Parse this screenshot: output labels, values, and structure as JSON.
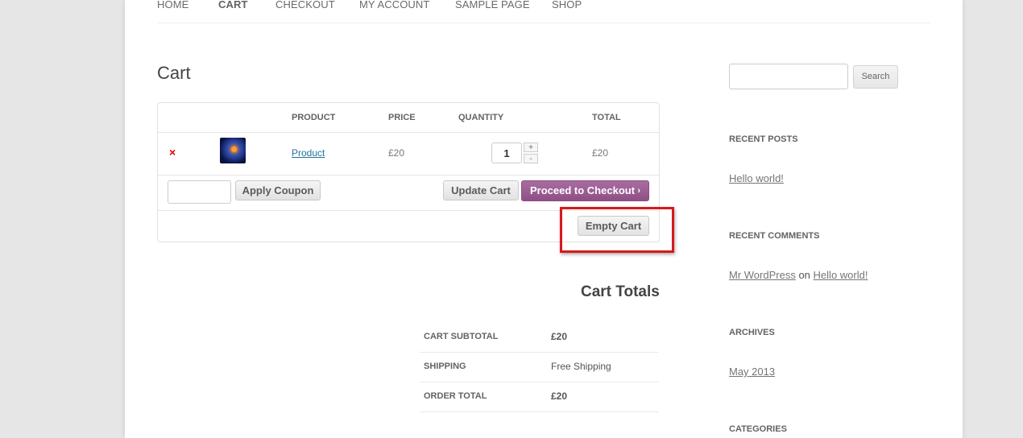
{
  "nav": {
    "items": [
      {
        "label": "HOME"
      },
      {
        "label": "CART",
        "active": true
      },
      {
        "label": "CHECKOUT"
      },
      {
        "label": "MY ACCOUNT"
      },
      {
        "label": "SAMPLE PAGE"
      },
      {
        "label": "SHOP"
      }
    ]
  },
  "page_title": "Cart",
  "cart": {
    "headers": {
      "product": "PRODUCT",
      "price": "PRICE",
      "quantity": "QUANTITY",
      "total": "TOTAL"
    },
    "row": {
      "remove_icon": "×",
      "product_link": "Product",
      "price": "£20",
      "quantity": "1",
      "qty_plus": "+",
      "qty_minus": "-",
      "total": "£20"
    },
    "coupon": {
      "placeholder": "",
      "button": "Apply Coupon"
    },
    "update_button": "Update Cart",
    "checkout_button": "Proceed to Checkout",
    "checkout_chevron": "›",
    "empty_button": "Empty Cart",
    "highlight_color": "#d7191c"
  },
  "totals": {
    "title": "Cart Totals",
    "rows": [
      {
        "label": "CART SUBTOTAL",
        "value": "£20"
      },
      {
        "label": "SHIPPING",
        "value": "Free Shipping"
      },
      {
        "label": "ORDER TOTAL",
        "value": "£20"
      }
    ]
  },
  "sidebar": {
    "search": {
      "placeholder": "",
      "button": "Search"
    },
    "recent_posts": {
      "title": "RECENT POSTS",
      "items": [
        "Hello world!"
      ]
    },
    "recent_comments": {
      "title": "RECENT COMMENTS",
      "author": "Mr WordPress",
      "on": "on",
      "post": "Hello world!"
    },
    "archives": {
      "title": "ARCHIVES",
      "items": [
        "May 2013"
      ]
    },
    "categories": {
      "title": "CATEGORIES"
    }
  },
  "colors": {
    "link": "#21759b",
    "checkout": "#9b5c8f",
    "remove": "#dd0000"
  }
}
